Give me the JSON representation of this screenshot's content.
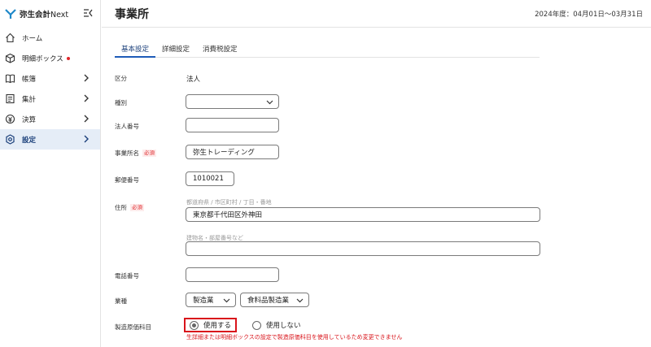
{
  "app": {
    "brand": "弥生会計",
    "brand_suffix": "Next",
    "brand_color": "#1e88c9"
  },
  "sidebar": {
    "items": [
      {
        "label": "ホーム",
        "icon": "home-icon"
      },
      {
        "label": "明細ボックス",
        "icon": "box-icon",
        "badge": "red-dot"
      },
      {
        "label": "帳簿",
        "icon": "book-icon"
      },
      {
        "label": "集計",
        "icon": "sheet-icon"
      },
      {
        "label": "決算",
        "icon": "settlement-icon"
      },
      {
        "label": "設定",
        "icon": "gear-icon",
        "active": true
      }
    ]
  },
  "header": {
    "title": "事業所",
    "fiscal_year": "2024年度：04月01日〜03月31日"
  },
  "tabs": [
    "基本設定",
    "詳細設定",
    "消費税設定"
  ],
  "form": {
    "category_label": "区分",
    "category_value": "法人",
    "type_label": "種別",
    "type_value": "",
    "corp_number_label": "法人番号",
    "corp_number_value": "",
    "office_name_label": "事業所名",
    "office_name_value": "弥生トレーディング",
    "postal_label": "郵便番号",
    "postal_value": "1010021",
    "address_label": "住所",
    "address_placeholder1": "都道府県 / 市区町村 / 丁目・番地",
    "address_value1": "東京都千代田区外神田",
    "address_placeholder2": "建物名・部屋番号など",
    "address_value2": "",
    "phone_label": "電話番号",
    "phone_value": "",
    "industry_label": "業種",
    "industry_value1": "製造業",
    "industry_value2": "食料品製造業",
    "manufacturing_label": "製造原価科目",
    "radio_use": "使用する",
    "radio_not_use": "使用しない",
    "required_tag": "必須",
    "warning": "生詳細または明細ボックスの設定で製造原価科目を使用しているため変更できません"
  },
  "colors": {
    "accent": "#1e5bb8",
    "active_bg": "#e5edf7",
    "required": "#e0262a",
    "highlight": "#d9141b"
  }
}
